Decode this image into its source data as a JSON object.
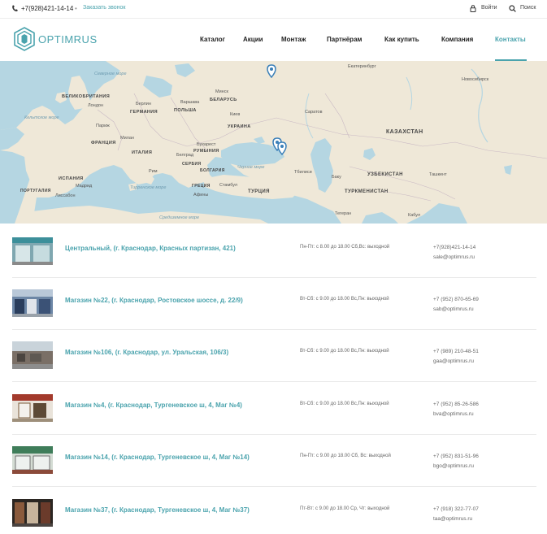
{
  "topbar": {
    "phone": "+7(928)421-14-14",
    "callback": "Заказать звонок",
    "login": "Войти",
    "search": "Поиск"
  },
  "logo": {
    "text": "OPTIMRUS"
  },
  "nav": {
    "items": [
      "Каталог",
      "Акции",
      "Монтаж",
      "Партнёрам",
      "Как купить",
      "Компания",
      "Контакты"
    ],
    "active": "Контакты"
  },
  "map": {
    "labels": [
      "Екатеринбург",
      "Новосибирск",
      "Северное море",
      "ВЕЛИКОБРИТАНИЯ",
      "Лондон",
      "Берлин",
      "ГЕРМАНИЯ",
      "Варшава",
      "ПОЛЬША",
      "БЕЛАРУСЬ",
      "Минск",
      "Кельтское море",
      "Париж",
      "Киев",
      "УКРАИНА",
      "Саратов",
      "ФРАНЦИЯ",
      "Милан",
      "ИТАЛИЯ",
      "Бухарест",
      "РУМЫНИЯ",
      "Белград",
      "СЕРБИЯ",
      "БОЛГАРИЯ",
      "Черное море",
      "Тбилиси",
      "Баку",
      "Рим",
      "Стамбул",
      "ИСПАНИЯ",
      "Мадрид",
      "Лиссабон",
      "ПОРТУГАЛИЯ",
      "Тирренское море",
      "ГРЕЦИЯ",
      "Афины",
      "Средиземное море",
      "ТУРЦИЯ",
      "КАЗАХСТАН",
      "УЗБЕКИСТАН",
      "Ташкент",
      "ТУРКМЕНИСТАН",
      "Тегеран",
      "Кабул"
    ],
    "pins": 3
  },
  "stores": [
    {
      "name": "Центральный, (г. Краснодар, Красных партизан, 421)",
      "hours": "Пн-Пт: с 8.00 до 18.00 Сб,Вс: выходной",
      "phone": "+7(928)421-14-14",
      "email": "sale@optimrus.ru"
    },
    {
      "name": "Магазин №22, (г. Краснодар, Ростовское шоссе, д. 22/9)",
      "hours": "Вт-Сб: с 9.00 до 18.00 Вс,Пн: выходной",
      "phone": "+7 (952) 870-65-69",
      "email": "sab@optimrus.ru"
    },
    {
      "name": "Магазин №106, (г. Краснодар, ул. Уральская, 106/3)",
      "hours": "Вт-Сб: с 9.00 до 18.00 Вс,Пн: выходной",
      "phone": "+7 (989) 210-48-51",
      "email": "gaa@optimrus.ru"
    },
    {
      "name": "Магазин №4, (г. Краснодар, Тургеневское ш, 4, Маг №4)",
      "hours": "Вт-Сб: с 9.00 до 18.00 Вс,Пн: выходной",
      "phone": "+7 (952) 85-26-586",
      "email": "bva@optimrus.ru"
    },
    {
      "name": "Магазин №14, (г. Краснодар, Тургеневское ш, 4, Маг №14)",
      "hours": "Пн-Пт: с 9.00 до 18.00 Сб, Вс: выходной",
      "phone": "+7 (952) 831-51-96",
      "email": "bgo@optimrus.ru"
    },
    {
      "name": "Магазин №37, (г. Краснодар, Тургеневское ш, 4, Маг №37)",
      "hours": "Пт-Вт: с 9.00 до 18.00 Ср, Чт: выходной",
      "phone": "+7 (918) 322-77-07",
      "email": "taa@optimrus.ru"
    }
  ],
  "colors": {
    "accent": "#4aa3ad",
    "land": "#efe8d8",
    "water": "#b5d6e2"
  }
}
